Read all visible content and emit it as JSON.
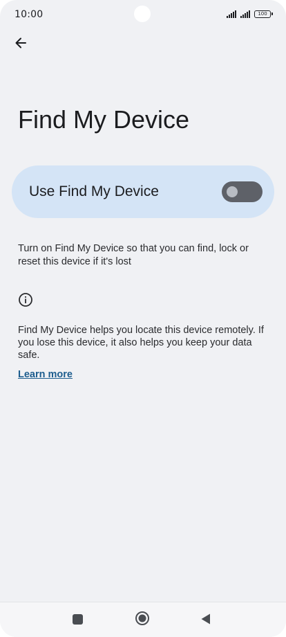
{
  "status_bar": {
    "time": "10:00",
    "battery": "100"
  },
  "header": {
    "back_icon": "arrow-left-icon",
    "title": "Find My Device"
  },
  "main_switch": {
    "label": "Use Find My Device",
    "checked": false
  },
  "summary": "Turn on Find My Device so that you can find, lock or reset this device if it's lost",
  "info": {
    "icon": "info-icon",
    "description": "Find My Device helps you locate this device remotely. If you lose this device, it also helps you keep your data safe.",
    "link_label": "Learn more"
  },
  "nav_bar": {
    "recents_icon": "square-icon",
    "home_icon": "circle-home-icon",
    "back_icon": "triangle-back-icon"
  },
  "colors": {
    "background": "#f0f1f4",
    "switch_card": "#d4e4f6",
    "toggle_off": "#5e6168",
    "link": "#1d5d8e"
  }
}
